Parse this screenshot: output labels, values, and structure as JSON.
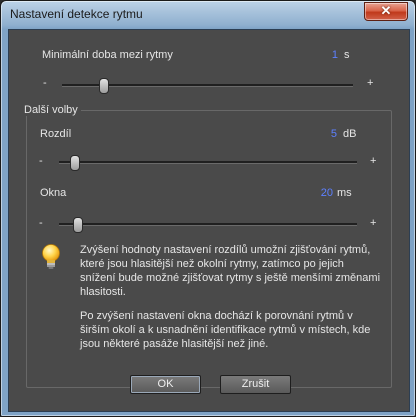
{
  "window": {
    "title": "Nastavení detekce rytmu",
    "close_glyph": "✕"
  },
  "min_interval": {
    "label": "Minimální doba mezi rytmy",
    "value": "1",
    "unit": "s",
    "minus": "-",
    "plus": "+",
    "slider_level": 0.14
  },
  "group": {
    "label": "Další volby",
    "difference": {
      "label": "Rozdíl",
      "value": "5",
      "unit": "dB",
      "minus": "-",
      "plus": "+",
      "slider_level": 0.05
    },
    "window": {
      "label": "Okna",
      "value": "20",
      "unit": "ms",
      "minus": "-",
      "plus": "+",
      "slider_level": 0.06
    },
    "info_icon": "lightbulb-icon",
    "info_p1": "Zvýšení hodnoty nastavení rozdílů umožní zjišťování rytmů, které jsou hlasitější než okolní rytmy, zatímco po jejich snížení bude možné zjišťovat rytmy s ještě menšími změnami hlasitosti.",
    "info_p2": "Po zvýšení nastavení okna dochází k porovnání rytmů v širším okolí a k usnadnění identifikace rytmů v místech, kde jsou některé pasáže hlasitější než jiné."
  },
  "buttons": {
    "ok": "OK",
    "cancel": "Zrušit"
  }
}
